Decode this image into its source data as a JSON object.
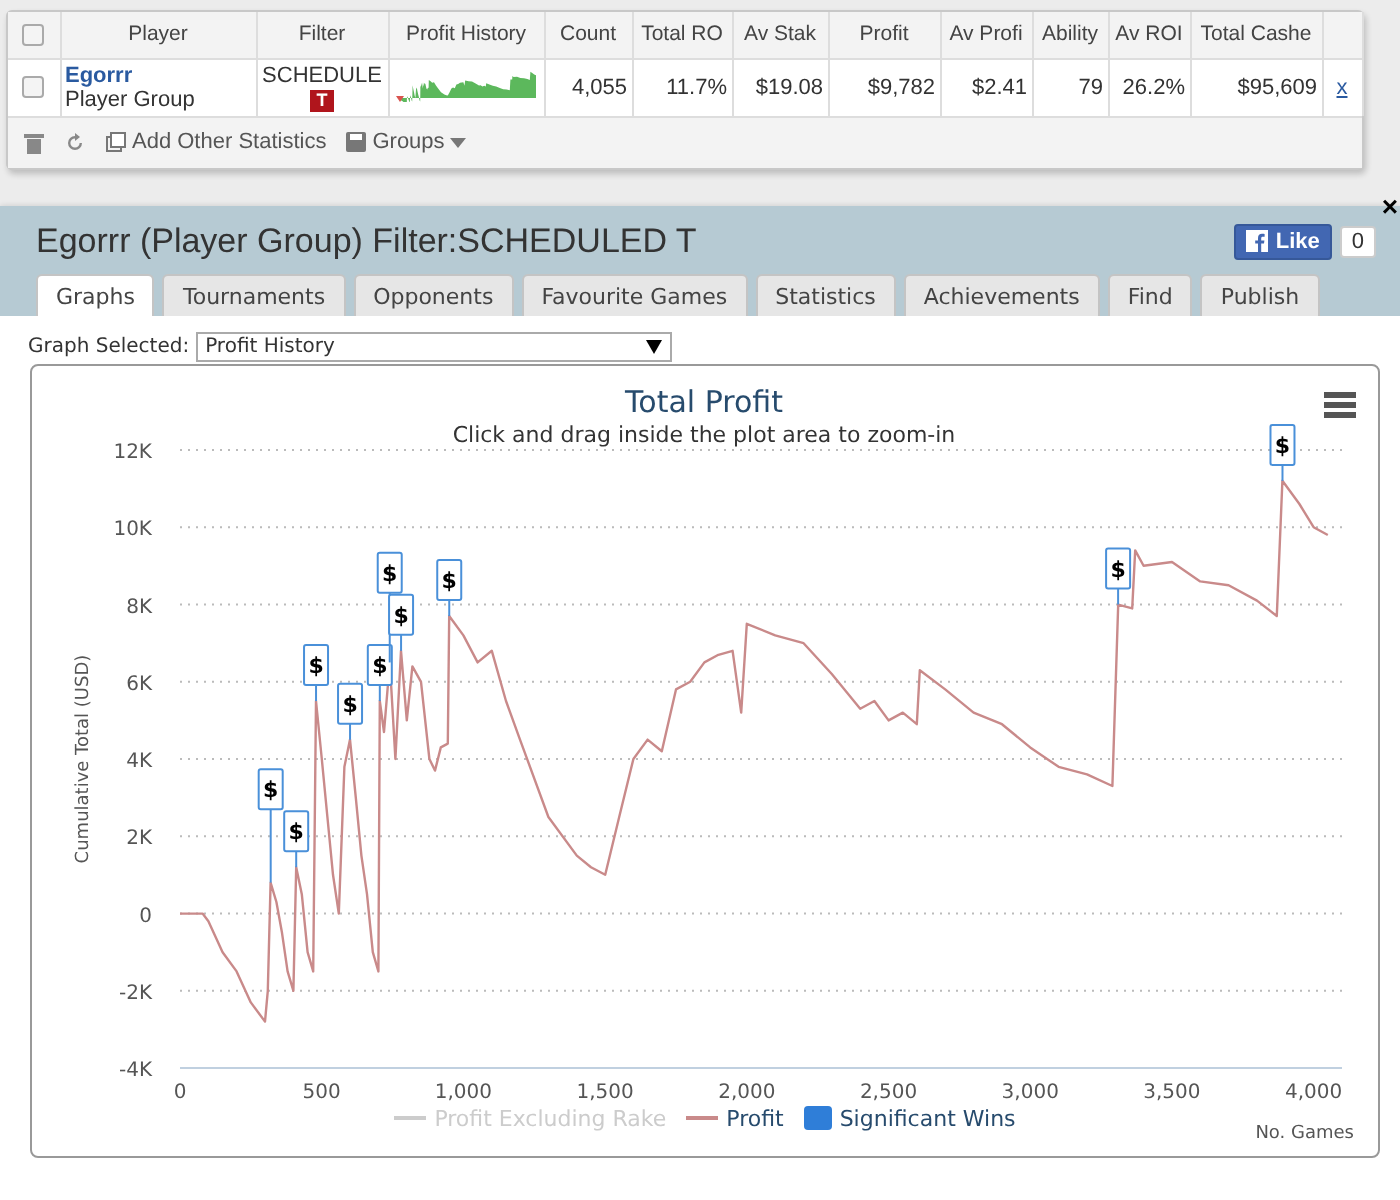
{
  "stats_table": {
    "columns": [
      "Player",
      "Filter",
      "Profit History",
      "Count",
      "Total RO",
      "Av Stak",
      "Profit",
      "Av Profi",
      "Ability",
      "Av ROI",
      "Total Cashe"
    ],
    "header_checked": false,
    "rows": [
      {
        "checked": false,
        "cells": [
          {
            "kind": "player",
            "text": "Egorrr",
            "sub": "Player Group"
          },
          {
            "kind": "filter",
            "text": "SCHEDULE",
            "badge": "T"
          },
          {
            "kind": "sparkline"
          },
          {
            "kind": "text",
            "text": "4,055"
          },
          {
            "kind": "text",
            "text": "11.7%"
          },
          {
            "kind": "text",
            "text": "$19.08"
          },
          {
            "kind": "text",
            "text": "$9,782"
          },
          {
            "kind": "text",
            "text": "$2.41"
          },
          {
            "kind": "text",
            "text": "79"
          },
          {
            "kind": "text",
            "text": "26.2%"
          },
          {
            "kind": "text",
            "text": "$95,609"
          }
        ],
        "remove": "x"
      }
    ],
    "footer": {
      "add": "Add Other Statistics",
      "groups": "Groups"
    }
  },
  "panel": {
    "title": "Egorrr (Player Group) Filter:SCHEDULED T",
    "like": "Like",
    "like_count": "0",
    "close": "×",
    "tabs": [
      {
        "label": "Graphs",
        "selected": true
      },
      {
        "label": "Tournaments",
        "selected": false
      },
      {
        "label": "Opponents",
        "selected": false
      },
      {
        "label": "Favourite Games",
        "selected": false
      },
      {
        "label": "Statistics",
        "selected": false
      },
      {
        "label": "Achievements",
        "selected": false
      },
      {
        "label": "Find",
        "selected": false
      },
      {
        "label": "Publish",
        "selected": false
      }
    ],
    "graph_select": {
      "label": "Graph Selected:",
      "value": "Profit History"
    },
    "chart": {
      "subtitle": "Click and drag inside the plot area to zoom-in",
      "legend": [
        {
          "kind": "line",
          "name": "Profit Excluding Rake",
          "visible": false,
          "color": "#cccccc"
        },
        {
          "kind": "series",
          "visible": true
        },
        {
          "kind": "flag",
          "name": "Significant Wins",
          "visible": true,
          "color": "#2f7ed8"
        }
      ],
      "chart_data": {
        "type": "line",
        "title": "Total Profit",
        "xlabel": "No. Games",
        "ylabel": "Cumulative Total (USD)",
        "xlim": [
          0,
          4100
        ],
        "ylim": [
          -4000,
          12000
        ],
        "grid": true,
        "x": [
          0,
          80,
          100,
          150,
          200,
          250,
          300,
          310,
          320,
          340,
          360,
          380,
          400,
          410,
          430,
          450,
          470,
          480,
          500,
          520,
          540,
          560,
          580,
          600,
          620,
          640,
          660,
          680,
          700,
          705,
          720,
          740,
          760,
          780,
          800,
          820,
          850,
          880,
          900,
          920,
          945,
          950,
          1000,
          1050,
          1100,
          1150,
          1200,
          1300,
          1400,
          1450,
          1500,
          1550,
          1600,
          1650,
          1700,
          1750,
          1800,
          1850,
          1900,
          1950,
          1980,
          2000,
          2100,
          2200,
          2300,
          2400,
          2450,
          2500,
          2550,
          2600,
          2610,
          2700,
          2800,
          2900,
          3000,
          3100,
          3200,
          3290,
          3310,
          3360,
          3370,
          3400,
          3500,
          3600,
          3700,
          3800,
          3870,
          3890,
          3950,
          4000,
          4050
        ],
        "series": [
          {
            "name": "Profit",
            "color": "#c98a8a",
            "values": [
              0,
              0,
              -200,
              -1000,
              -1500,
              -2300,
              -2800,
              -2000,
              800,
              300,
              -500,
              -1500,
              -2000,
              1200,
              500,
              -1000,
              -1500,
              5500,
              4000,
              2500,
              1000,
              0,
              3800,
              4500,
              3000,
              1500,
              500,
              -1000,
              -1500,
              5500,
              4700,
              6500,
              4000,
              6800,
              5000,
              6400,
              6000,
              4000,
              3700,
              4300,
              4400,
              7700,
              7200,
              6500,
              6800,
              5500,
              4500,
              2500,
              1500,
              1200,
              1000,
              2500,
              4000,
              4500,
              4200,
              5800,
              6000,
              6500,
              6700,
              6800,
              5200,
              7500,
              7200,
              7000,
              6200,
              5300,
              5500,
              5000,
              5200,
              4900,
              6300,
              5800,
              5200,
              4900,
              4300,
              3800,
              3600,
              3300,
              8000,
              7900,
              9400,
              9000,
              9100,
              8600,
              8500,
              8100,
              7700,
              11200,
              10600,
              10000,
              9800
            ]
          }
        ],
        "xticks": [
          {
            "value": 0,
            "label": "0"
          },
          {
            "value": 500,
            "label": "500"
          },
          {
            "value": 1000,
            "label": "1,000"
          },
          {
            "value": 1500,
            "label": "1,500"
          },
          {
            "value": 2000,
            "label": "2,000"
          },
          {
            "value": 2500,
            "label": "2,500"
          },
          {
            "value": 3000,
            "label": "3,000"
          },
          {
            "value": 3500,
            "label": "3,500"
          },
          {
            "value": 4000,
            "label": "4,000"
          }
        ],
        "yticks": [
          {
            "value": -4000,
            "label": "-4K"
          },
          {
            "value": -2000,
            "label": "-2K"
          },
          {
            "value": 0,
            "label": "0"
          },
          {
            "value": 2000,
            "label": "2K"
          },
          {
            "value": 4000,
            "label": "4K"
          },
          {
            "value": 6000,
            "label": "6K"
          },
          {
            "value": 8000,
            "label": "8K"
          },
          {
            "value": 10000,
            "label": "10K"
          },
          {
            "value": 12000,
            "label": "12K"
          }
        ],
        "annotations": [
          {
            "x": 320,
            "y": 800,
            "text": "$"
          },
          {
            "x": 410,
            "y": 1200,
            "text": "$"
          },
          {
            "x": 480,
            "y": 5500,
            "text": "$"
          },
          {
            "x": 600,
            "y": 4500,
            "text": "$"
          },
          {
            "x": 705,
            "y": 5500,
            "text": "$"
          },
          {
            "x": 740,
            "y": 6500,
            "text": "$"
          },
          {
            "x": 780,
            "y": 6800,
            "text": "$"
          },
          {
            "x": 950,
            "y": 7700,
            "text": "$"
          },
          {
            "x": 3310,
            "y": 8000,
            "text": "$"
          },
          {
            "x": 3890,
            "y": 11200,
            "text": "$"
          }
        ]
      }
    }
  }
}
